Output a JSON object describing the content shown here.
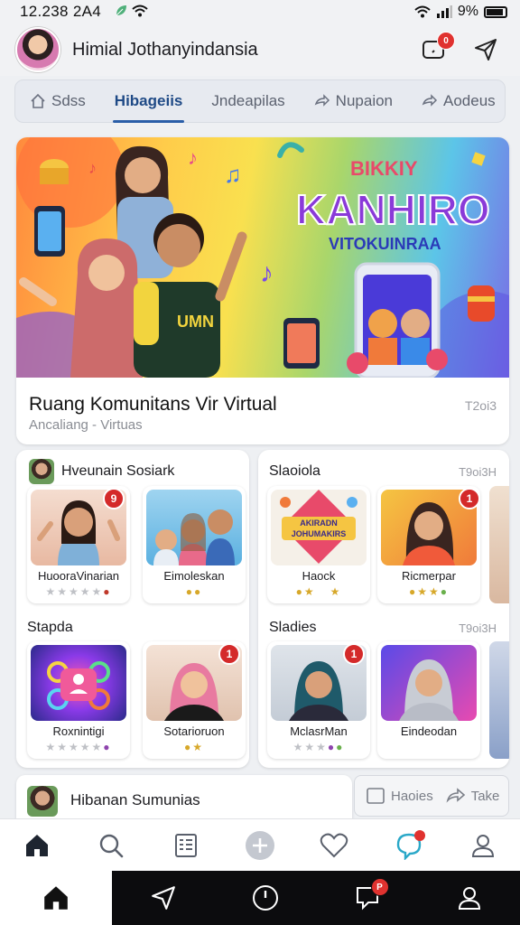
{
  "status_bar": {
    "time": "12.238 2A4",
    "battery": "9%"
  },
  "header": {
    "title": "Himial Jothanyindansia",
    "notif_count": "0"
  },
  "tabs": [
    {
      "label": "Sdss",
      "icon": "home-icon"
    },
    {
      "label": "Hibageiis",
      "icon": ""
    },
    {
      "label": "Jndeapilas",
      "icon": ""
    },
    {
      "label": "Nupaion",
      "icon": "share-icon"
    },
    {
      "label": "Aodeus",
      "icon": "share-icon"
    }
  ],
  "hero": {
    "banner_top": "BIKKIY",
    "banner_title": "KANHIRO",
    "banner_sub": "VITOKUINRAA",
    "shirt_text": "UMN",
    "title": "Ruang Komunitans Vir Virtual",
    "subtitle": "Ancaliang - Virtuas",
    "meta": "T2oi3"
  },
  "sections": {
    "left_top": {
      "title": "Hveunain Sosiark",
      "tiles": [
        {
          "name": "HuooraVinarian",
          "badge": "9"
        },
        {
          "name": "Eimoleskan",
          "badge": ""
        }
      ]
    },
    "right_top": {
      "title": "Slaoiola",
      "meta": "T9oi3H",
      "tiles": [
        {
          "name": "Haock",
          "badge": "",
          "art_line1": "AKIRADN",
          "art_line2": "JOHUMAKIRS"
        },
        {
          "name": "Ricmerpar",
          "badge": "1"
        }
      ]
    },
    "left_bottom": {
      "title": "Stapda",
      "tiles": [
        {
          "name": "Roxnintigi",
          "badge": ""
        },
        {
          "name": "Sotarioruon",
          "badge": "1"
        }
      ]
    },
    "right_bottom": {
      "title": "Sladies",
      "meta": "T9oi3H",
      "tiles": [
        {
          "name": "MclasrMan",
          "badge": "1"
        },
        {
          "name": "Eindeodan",
          "badge": ""
        }
      ]
    }
  },
  "bottom_strip": {
    "title": "Hibanan Sumunias",
    "action1": "Haoies",
    "action2": "Take"
  },
  "nav_bottom": {
    "chat_badge": "P"
  },
  "colors": {
    "accent": "#2a5ea8",
    "badge_red": "#d42a2a",
    "bottom_bar": "#0c0c0e"
  }
}
